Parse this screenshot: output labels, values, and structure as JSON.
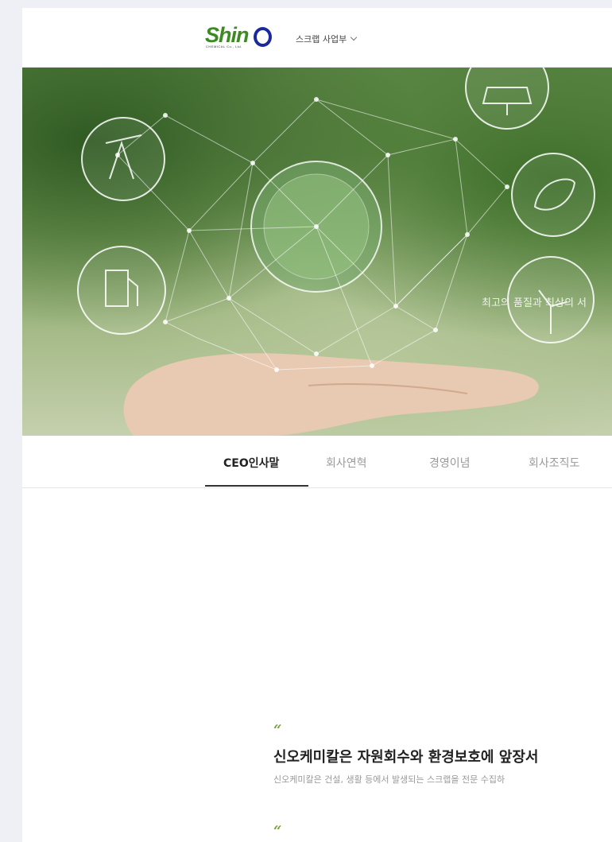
{
  "header": {
    "logo": {
      "text": "Shin",
      "o": "o",
      "sub": "CHEMICAL Co., Ltd."
    },
    "business_menu": {
      "label": "스크랩 사업부"
    }
  },
  "hero": {
    "caption": "최고의 품질과 최상의 서"
  },
  "tabs": [
    {
      "label": "CEO인사말",
      "active": true
    },
    {
      "label": "회사연혁",
      "active": false
    },
    {
      "label": "경영이념",
      "active": false
    },
    {
      "label": "회사조직도",
      "active": false
    }
  ],
  "content": {
    "quote_mark": "“",
    "headline": "신오케미칼은 자원회수와 환경보호에 앞장서",
    "subtext": "신오케미칼은 건설, 생활 등에서 발생되는 스크랩을 전문 수집하"
  },
  "colors": {
    "brand_green": "#3b8a22",
    "brand_blue": "#1b2a9a",
    "quote_green": "#7aa53c"
  }
}
